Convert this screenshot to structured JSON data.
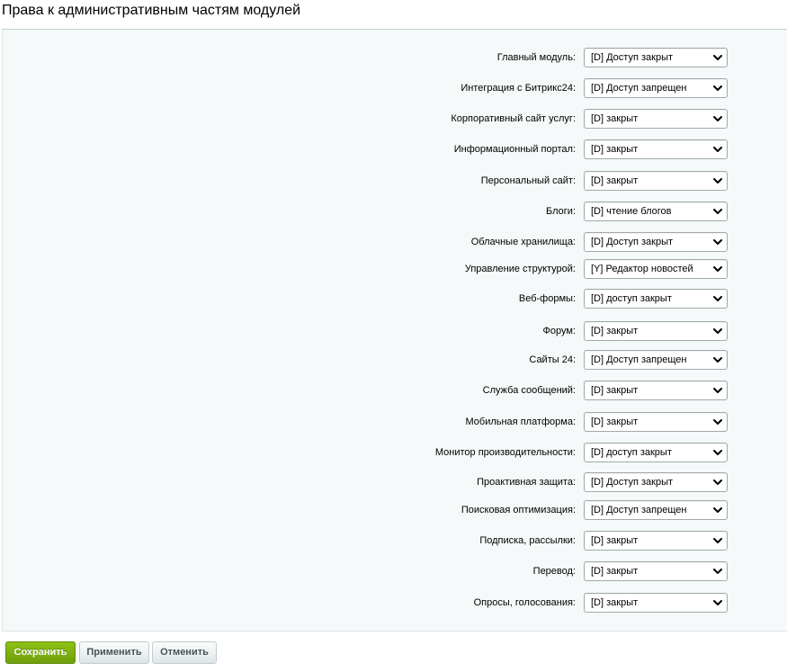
{
  "page": {
    "title": "Права к административным частям модулей"
  },
  "permissions": [
    {
      "label": "Главный модуль:",
      "value": "[D] Доступ закрыт"
    },
    {
      "label": "Интеграция с Битрикс24:",
      "value": "[D] Доступ запрещен"
    },
    {
      "label": "Корпоративный сайт услуг:",
      "value": "[D] закрыт"
    },
    {
      "label": "Информационный портал:",
      "value": "[D] закрыт"
    },
    {
      "label": "Персональный сайт:",
      "value": "[D] закрыт"
    },
    {
      "label": "Блоги:",
      "value": "[D] чтение блогов"
    },
    {
      "label": "Облачные хранилища:",
      "value": "[D] Доступ закрыт"
    },
    {
      "label": "Управление структурой:",
      "value": "[Y] Редактор новостей"
    },
    {
      "label": "Веб-формы:",
      "value": "[D] доступ закрыт"
    },
    {
      "label": "Форум:",
      "value": "[D] закрыт"
    },
    {
      "label": "Сайты 24:",
      "value": "[D] Доступ запрещен"
    },
    {
      "label": "Служба сообщений:",
      "value": "[D] закрыт"
    },
    {
      "label": "Мобильная платформа:",
      "value": "[D] закрыт"
    },
    {
      "label": "Монитор производительности:",
      "value": "[D] доступ закрыт"
    },
    {
      "label": "Проактивная защита:",
      "value": "[D] Доступ закрыт"
    },
    {
      "label": "Поисковая оптимизация:",
      "value": "[D] Доступ запрещен"
    },
    {
      "label": "Подписка, рассылки:",
      "value": "[D] закрыт"
    },
    {
      "label": "Перевод:",
      "value": "[D] закрыт"
    },
    {
      "label": "Опросы, голосования:",
      "value": "[D] закрыт"
    }
  ],
  "buttons": {
    "save_label": "Сохранить",
    "apply_label": "Применить",
    "cancel_label": "Отменить"
  },
  "colors": {
    "save_button": "#7fb011",
    "panel_background": "#f5f9f9"
  },
  "icons": {
    "select_arrow": "chevron-down-icon"
  }
}
